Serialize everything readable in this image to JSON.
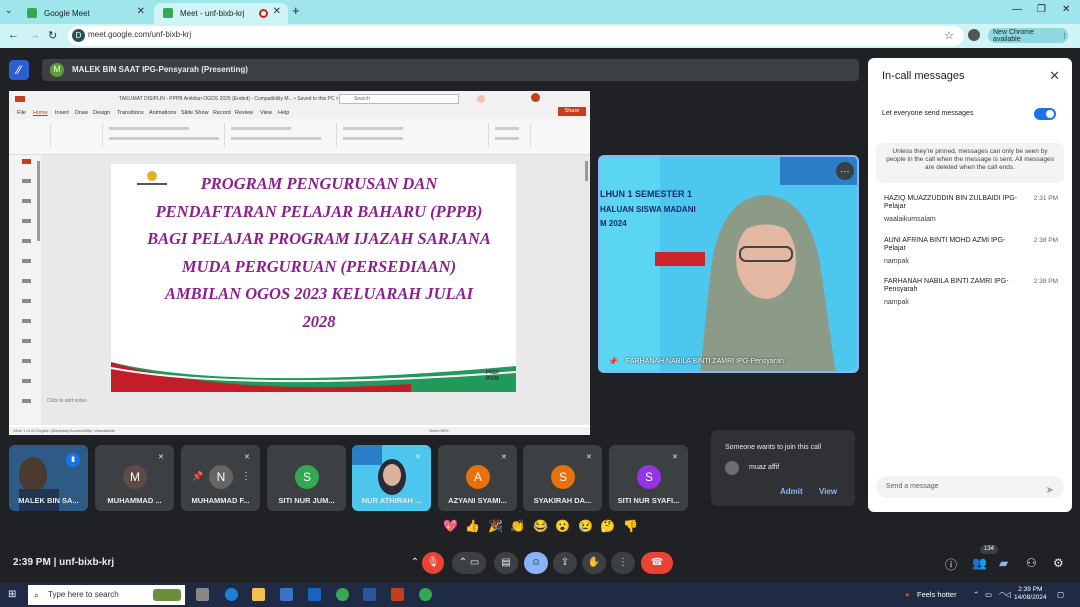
{
  "browser": {
    "tabs": [
      {
        "label": "Google Meet"
      },
      {
        "label": "Meet - unf-bixb-krj"
      }
    ],
    "url": "meet.google.com/unf-bixb-krj",
    "new_chrome": "New Chrome available"
  },
  "meet": {
    "presenting": "MALEK BIN SAAT IPG-Pensyarah (Presenting)",
    "presenter_initial": "M",
    "slide": {
      "window_title": "TAKLIMAT DISIPLIN - PPPB Ambilan OGOS 2025 (Ended)  -  Compatibility M...  •  Saved to this PC ˅",
      "search": "Search",
      "share": "Share",
      "menu": [
        "File",
        "Home",
        "Insert",
        "Draw",
        "Design",
        "Transitions",
        "Animations",
        "Slide Show",
        "Record",
        "Review",
        "View",
        "Help"
      ],
      "lines": [
        "PROGRAM PENGURUSAN DAN",
        "PENDAFTARAN  PELAJAR  BAHARU (PPPB)",
        "BAGI PELAJAR PROGRAM IJAZAH  SARJANA",
        "MUDA  PERGURUAN  (PERSEDIAAN)",
        "AMBILAN OGOS 2023  KELUARAH JULAI",
        "2028"
      ],
      "prep": [
        "PREP",
        "IPGM"
      ],
      "notes": "Click to add notes",
      "status": "Slide 1 of 41     English (Malaysia)     Accessibility: Unavailable",
      "status_right": "Notes            68%"
    },
    "speaker": {
      "name": "FARHANAH NABILA BINTI ZAMRI IPG-Pensyarah",
      "banner": "LHUN 1 SEMESTER 1",
      "banner2": "HALUAN SISWA MADANI",
      "banner3": "M 2024",
      "more": "⋯"
    },
    "participants": [
      {
        "name": "MALEK BIN SA...",
        "initial": "",
        "color": "#2f5f8f"
      },
      {
        "name": "MUHAMMAD ...",
        "initial": "M",
        "color": "#5f4b45"
      },
      {
        "name": "MUHAMMAD F...",
        "initial": "N",
        "color": "#666"
      },
      {
        "name": "SITI NUR JUM...",
        "initial": "S",
        "color": "#34a853"
      },
      {
        "name": "NUR ATHIRAH ...",
        "initial": "",
        "color": "#3a7fc0"
      },
      {
        "name": "AZYANI SYAMI...",
        "initial": "A",
        "color": "#e8710a"
      },
      {
        "name": "SYAKIRAH DA...",
        "initial": "S",
        "color": "#e8710a"
      },
      {
        "name": "SITI NUR SYAFI...",
        "initial": "S",
        "color": "#9334e6"
      }
    ],
    "reactions": [
      "💖",
      "👍",
      "🎉",
      "👏",
      "😂",
      "😮",
      "😢",
      "🤔",
      "👎"
    ],
    "time_code": "2:39 PM  |  unf-bixb-krj",
    "people_count": "134"
  },
  "panel": {
    "title": "In-call messages",
    "toggle_label": "Let everyone send messages",
    "note": "Unless they're pinned, messages can only be seen by people in the call when the message is sent. All messages are deleted when the call ends.",
    "messages": [
      {
        "name": "HAZIQ MUAZZUDDIN BIN ZULBAIDI IPG-Pelajar",
        "time": "2:31 PM",
        "text": "waalaikumsalam"
      },
      {
        "name": "AUNI AFRINA BINTI MOHD AZMI IPG-Pelajar",
        "time": "2:38 PM",
        "text": "nampak"
      },
      {
        "name": "FARHANAH NABILA BINTI ZAMRI IPG-Pensyarah",
        "time": "2:38 PM",
        "text": "nampak"
      }
    ],
    "input_placeholder": "Send a message"
  },
  "knock": {
    "title": "Someone wants to join this call",
    "name": "muaz affif",
    "admit": "Admit",
    "view": "View"
  },
  "taskbar": {
    "search": "Type here to search",
    "weather": "Feels hotter",
    "time": "2:39 PM",
    "date": "14/08/2024"
  }
}
